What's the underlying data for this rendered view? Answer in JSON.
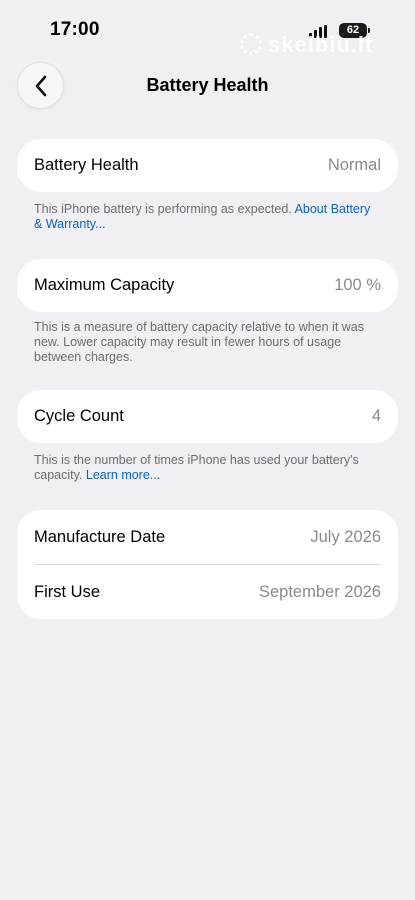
{
  "status_bar": {
    "time": "17:00",
    "battery_level": "62",
    "watermark": "skelbiu.lt"
  },
  "nav": {
    "title": "Battery Health",
    "back_icon": "chevron-left-icon"
  },
  "sections": {
    "battery_health": {
      "label": "Battery Health",
      "value": "Normal",
      "footnote_text": "This iPhone battery is performing as expected. ",
      "footnote_link": "About Battery & Warranty..."
    },
    "maximum_capacity": {
      "label": "Maximum Capacity",
      "value": "100 %",
      "footnote_text": "This is a measure of battery capacity relative to when it was new. Lower capacity may result in fewer hours of usage between charges."
    },
    "cycle_count": {
      "label": "Cycle Count",
      "value": "4",
      "footnote_text": "This is the number of times iPhone has used your battery's capacity. ",
      "footnote_link": "Learn more..."
    },
    "dates": {
      "manufacture_label": "Manufacture Date",
      "manufacture_value": "July 2026",
      "first_use_label": "First Use",
      "first_use_value": "September 2026"
    }
  },
  "colors": {
    "background": "#efeff4",
    "card": "#ffffff",
    "link": "#0a64c8",
    "secondary_text": "#8a8a8e"
  }
}
